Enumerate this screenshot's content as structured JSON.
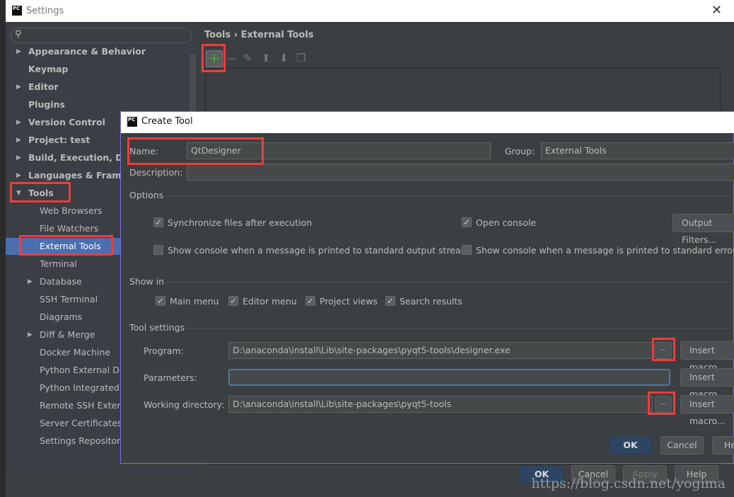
{
  "window": {
    "title": "Settings"
  },
  "sidebar": {
    "items": [
      {
        "label": "Appearance & Behavior",
        "arrow": true,
        "bold": true
      },
      {
        "label": "Keymap",
        "bold": true
      },
      {
        "label": "Editor",
        "arrow": true,
        "bold": true
      },
      {
        "label": "Plugins",
        "bold": true
      },
      {
        "label": "Version Control",
        "arrow": true,
        "bold": true
      },
      {
        "label": "Project: test",
        "arrow": true,
        "bold": true
      },
      {
        "label": "Build, Execution, Dep",
        "arrow": true,
        "bold": true
      },
      {
        "label": "Languages & Framew",
        "arrow": true,
        "bold": true
      },
      {
        "label": "Tools",
        "expanded": true,
        "bold": true
      },
      {
        "label": "Web Browsers"
      },
      {
        "label": "File Watchers"
      },
      {
        "label": "External Tools",
        "selected": true
      },
      {
        "label": "Terminal"
      },
      {
        "label": "Database",
        "arrow": true
      },
      {
        "label": "SSH Terminal"
      },
      {
        "label": "Diagrams"
      },
      {
        "label": "Diff & Merge",
        "arrow": true
      },
      {
        "label": "Docker Machine"
      },
      {
        "label": "Python External Doc"
      },
      {
        "label": "Python Integrated T"
      },
      {
        "label": "Remote SSH Externa"
      },
      {
        "label": "Server Certificates"
      },
      {
        "label": "Settings Repository"
      }
    ]
  },
  "main": {
    "breadcrumb": "Tools › External Tools",
    "toolbar": [
      "add-icon",
      "remove-icon",
      "edit-icon",
      "move-up-icon",
      "move-down-icon",
      "copy-icon"
    ]
  },
  "footer": {
    "ok": "OK",
    "cancel": "Cancel",
    "apply": "Apply",
    "help": "Help"
  },
  "dialog": {
    "title": "Create Tool",
    "name_label": "Name:",
    "name_value": "QtDesigner",
    "group_label": "Group:",
    "group_value": "External Tools",
    "description_label": "Description:",
    "description_value": "",
    "options_label": "Options",
    "opt_sync": {
      "label": "Synchronize files after execution",
      "checked": true
    },
    "opt_open_console": {
      "label": "Open console",
      "checked": true
    },
    "output_filters": "Output Filters...",
    "opt_stdout": {
      "label": "Show console when a message is printed to standard output stream",
      "checked": false
    },
    "opt_stderr": {
      "label": "Show console when a message is printed to standard error stream",
      "checked": false
    },
    "show_in_label": "Show in",
    "show_in": [
      {
        "label": "Main menu",
        "checked": true
      },
      {
        "label": "Editor menu",
        "checked": true
      },
      {
        "label": "Project views",
        "checked": true
      },
      {
        "label": "Search results",
        "checked": true
      }
    ],
    "tool_settings_label": "Tool settings",
    "program_label": "Program:",
    "program_value": "D:\\anaconda\\install\\Lib\\site-packages\\pyqt5-tools\\designer.exe",
    "parameters_label": "Parameters:",
    "parameters_value": "",
    "workdir_label": "Working directory:",
    "workdir_value": "D:\\anaconda\\install\\Lib\\site-packages\\pyqt5-tools",
    "browse": "...",
    "insert_macro": "Insert macro...",
    "ok": "OK",
    "cancel": "Cancel",
    "help": "Help"
  },
  "watermark": "https://blog.csdn.net/yogima",
  "colors": {
    "highlight": "#f03c3c",
    "selection": "#4b6eaf",
    "add": "#3fae3f"
  }
}
